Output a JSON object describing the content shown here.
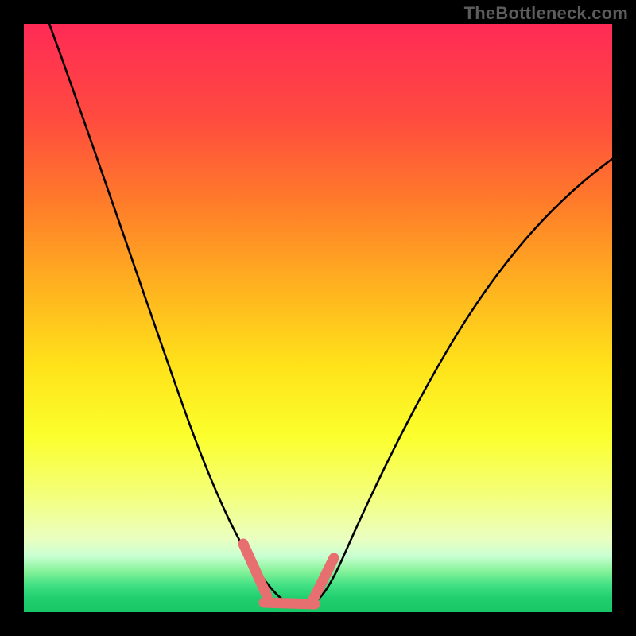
{
  "watermark": {
    "text": "TheBottleneck.com"
  },
  "colors": {
    "background_black": "#000000",
    "curve_black": "#000000",
    "marker": "#e76f6f",
    "gradient_top": "#ff2a56",
    "gradient_upper": "#ff6a2e",
    "gradient_mid": "#ffd21f",
    "gradient_lower": "#f7ff55",
    "gradient_pale": "#eaffc0",
    "gradient_green1": "#86f29a",
    "gradient_green2": "#2adf7a",
    "gradient_green3": "#17c765"
  },
  "chart_data": {
    "type": "line",
    "title": "",
    "xlabel": "",
    "ylabel": "",
    "xlim": [
      0,
      100
    ],
    "ylim": [
      0,
      100
    ],
    "x": [
      4,
      8,
      12,
      16,
      20,
      24,
      28,
      32,
      34,
      36,
      38,
      40,
      42,
      44,
      46,
      50,
      55,
      60,
      65,
      70,
      75,
      80,
      85,
      90,
      95,
      100
    ],
    "series": [
      {
        "name": "bottleneck-curve",
        "values": [
          100,
          90,
          80,
          70,
          60,
          50,
          40,
          28,
          22,
          15,
          8,
          3,
          1,
          1,
          3,
          12,
          23,
          33,
          41,
          48,
          53,
          57,
          60,
          62,
          64,
          65
        ]
      }
    ],
    "marker_segments": [
      {
        "x": [
          36,
          40
        ],
        "y": [
          15,
          3
        ]
      },
      {
        "x": [
          40,
          46
        ],
        "y": [
          2,
          2
        ]
      },
      {
        "x": [
          46,
          49
        ],
        "y": [
          2,
          11
        ]
      }
    ],
    "note": "Values estimated from pixel positions; chart has no visible axis ticks or labels."
  }
}
